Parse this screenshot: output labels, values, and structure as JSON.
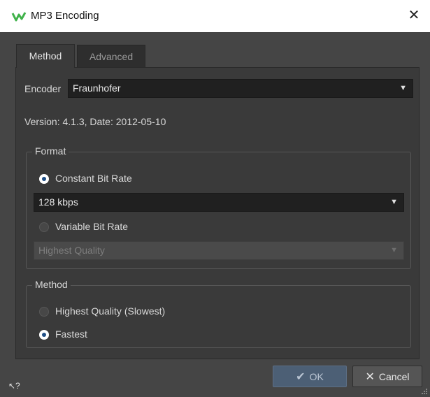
{
  "window": {
    "title": "MP3 Encoding",
    "close_glyph": "✕"
  },
  "tabs": [
    {
      "label": "Method",
      "active": true
    },
    {
      "label": "Advanced",
      "active": false
    }
  ],
  "encoder": {
    "label": "Encoder",
    "value": "Fraunhofer"
  },
  "version_text": "Version: 4.1.3, Date: 2012-05-10",
  "format": {
    "title": "Format",
    "cbr_label": "Constant Bit Rate",
    "cbr_selected": true,
    "cbr_value": "128 kbps",
    "vbr_label": "Variable Bit Rate",
    "vbr_selected": false,
    "vbr_value": "Highest Quality"
  },
  "method": {
    "title": "Method",
    "options": [
      {
        "label": "Highest Quality (Slowest)",
        "selected": false
      },
      {
        "label": "Fastest",
        "selected": true
      }
    ]
  },
  "buttons": {
    "ok": "OK",
    "cancel": "Cancel"
  },
  "help_glyph": "↖?",
  "icons": {
    "app": "wavelab-icon",
    "dropdown": "chevron-down-icon",
    "ok": "checkmark-icon",
    "cancel": "x-icon",
    "help": "context-help-icon",
    "grip": "resize-grip-icon"
  },
  "colors": {
    "accent_green": "#3fb24a",
    "ok_button": "#4c5f75",
    "radio_dot": "#1f4f86"
  }
}
